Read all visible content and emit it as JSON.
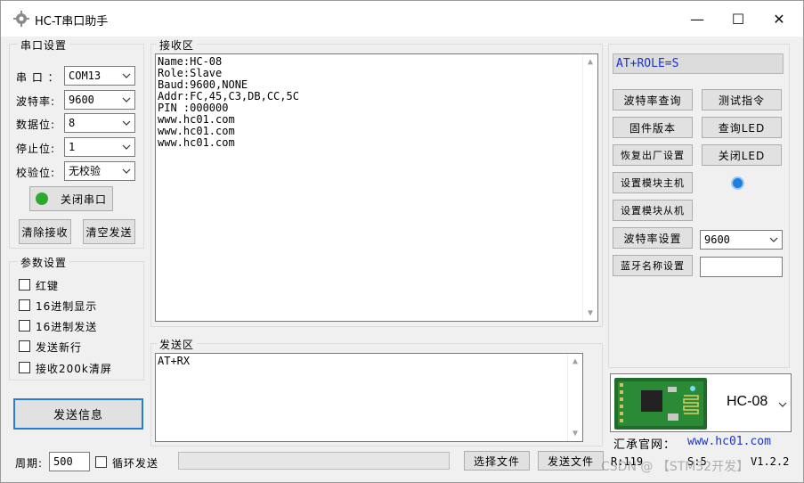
{
  "window": {
    "title": "HC-T串口助手",
    "minimize": "—",
    "maximize": "☐",
    "close": "✕"
  },
  "serial": {
    "group_label": "串口设置",
    "port_label": "串 口 ：",
    "port_value": "COM13",
    "baud_label": "波特率:",
    "baud_value": "9600",
    "databits_label": "数据位:",
    "databits_value": "8",
    "stopbits_label": "停止位:",
    "stopbits_value": "1",
    "parity_label": "校验位:",
    "parity_value": "无校验",
    "toggle_button": "关闭串口",
    "status_color": "#2ea82e",
    "clear_recv_button": "清除接收",
    "clear_send_button": "清空发送"
  },
  "params": {
    "group_label": "参数设置",
    "options": [
      "红键",
      "16进制显示",
      "16进制发送",
      "发送新行",
      "接收200k清屏"
    ]
  },
  "send_info_button": "发送信息",
  "receive": {
    "label": "接收区",
    "lines": [
      "Name:HC-08",
      "Role:Slave",
      "Baud:9600,NONE",
      "Addr:FC,45,C3,DB,CC,5C",
      "PIN :000000",
      "www.hc01.com",
      "www.hc01.com",
      "www.hc01.com"
    ]
  },
  "send": {
    "label": "发送区",
    "text": "AT+RX"
  },
  "right": {
    "command_display": "AT+ROLE=S",
    "command_color": "#1a33c8",
    "buttons": {
      "query_baud": "波特率查询",
      "test_cmd": "测试指令",
      "firmware": "固件版本",
      "query_led": "查询LED",
      "factory_reset": "恢复出厂设置",
      "close_led": "关闭LED",
      "set_master": "设置模块主机",
      "set_slave": "设置模块从机",
      "set_baud": "波特率设置",
      "bt_name": "蓝牙名称设置"
    },
    "baud_set_value": "9600",
    "bt_name_value": "",
    "led_color": "#1e7fe0"
  },
  "module": {
    "name": "HC-08",
    "website_label": "汇承官网：",
    "website": "www.hc01.com",
    "website_color": "#1a33c8"
  },
  "bottom": {
    "period_label": "周期:",
    "period_value": "500",
    "loop_send_label": "循环发送",
    "select_file_button": "选择文件",
    "send_file_button": "发送文件",
    "r_count": "R:119",
    "s_count": "S:5",
    "version": "V1.2.2",
    "watermark": "CSDN @ 【STM32开发】"
  }
}
